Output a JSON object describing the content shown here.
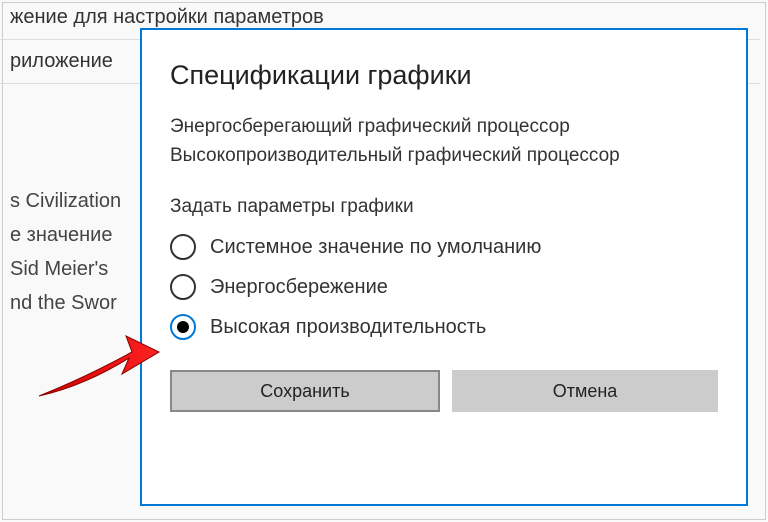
{
  "background": {
    "line1": "жение для настройки параметров",
    "line2": "риложение",
    "game1": "s Civilization",
    "game2": "е значение",
    "game3": "Sid Meier's",
    "game4": "nd the Swor"
  },
  "dialog": {
    "title": "Спецификации графики",
    "spec1": "Энергосберегающий графический процессор",
    "spec2": "Высокопроизводительный графический процессор",
    "subhead": "Задать параметры графики",
    "options": [
      {
        "label": "Системное значение по умолчанию",
        "selected": false
      },
      {
        "label": "Энергосбережение",
        "selected": false
      },
      {
        "label": "Высокая производительность",
        "selected": true
      }
    ],
    "save": "Сохранить",
    "cancel": "Отмена"
  }
}
